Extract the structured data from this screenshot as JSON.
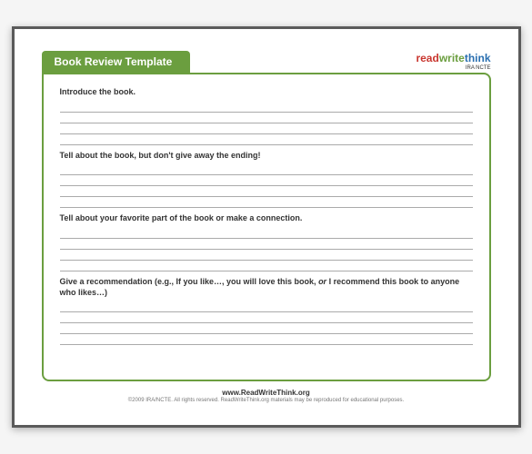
{
  "header": {
    "title": "Book Review Template",
    "logo": {
      "read": "read",
      "write": "write",
      "think": "think",
      "sub": "IRA  NCTE"
    }
  },
  "sections": {
    "s1": {
      "prompt": "Introduce the book."
    },
    "s2": {
      "prompt": "Tell about the book, but don't give away the ending!"
    },
    "s3": {
      "prompt": "Tell about your favorite part of the book or make a connection."
    },
    "s4": {
      "prompt_pre": "Give a recommendation (e.g., If you like…, you will love this book, ",
      "prompt_italic": "or",
      "prompt_post": " I recommend this book to anyone who likes…)"
    }
  },
  "footer": {
    "url": "www.ReadWriteThink.org",
    "copyright": "©2009 IRA/NCTE. All rights reserved. ReadWriteThink.org materials may be reproduced for educational purposes."
  }
}
